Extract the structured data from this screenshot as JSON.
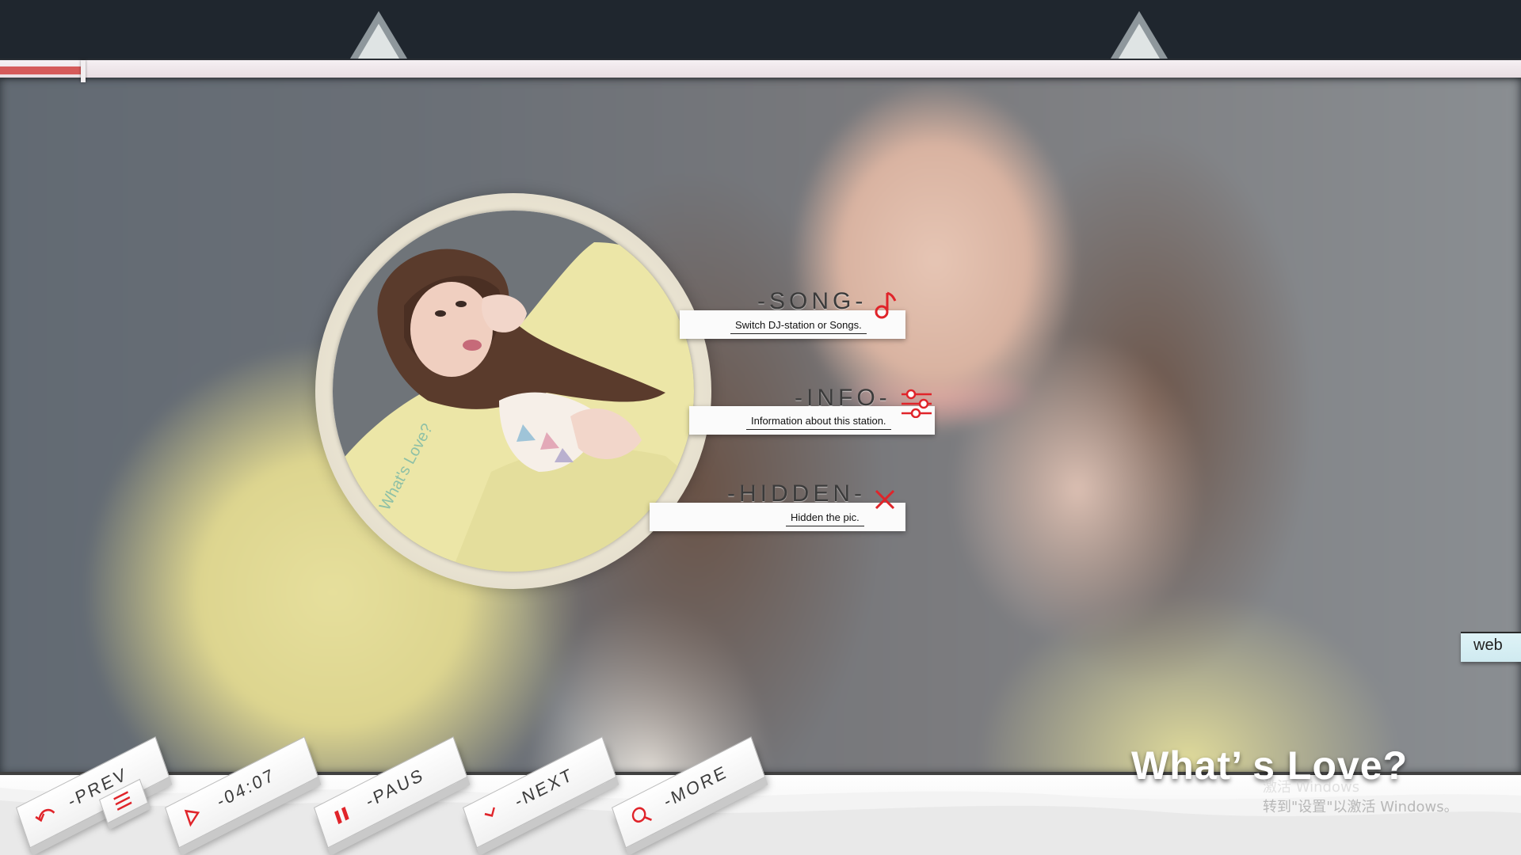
{
  "menu": {
    "song": {
      "title": "-SONG-",
      "desc": "Switch DJ-station or Songs.",
      "icon": "music-note-icon"
    },
    "info": {
      "title": "-INFO-",
      "desc": "Information about this station.",
      "icon": "sliders-icon"
    },
    "hidden": {
      "title": "-HIDDEN-",
      "desc": "Hidden the pic.",
      "icon": "close-icon"
    }
  },
  "controls": {
    "prev": {
      "label": "-PREV",
      "icon": "undo-arrow-icon"
    },
    "time": {
      "label": "-04:07",
      "icon": "play-icon"
    },
    "pause": {
      "label": "-PAUS",
      "icon": "pause-icon"
    },
    "next": {
      "label": "-NEXT",
      "icon": "chevron-right-icon"
    },
    "more": {
      "label": "-MORE",
      "icon": "search-icon"
    },
    "list_icon": "list-icon"
  },
  "playback": {
    "progress": 0.054
  },
  "song_title": "What’ s Love?",
  "album_text": "What's Love?",
  "web_tab": "web",
  "watermark": {
    "line1": "激活 Windows",
    "line2": "转到\"设置\"以激活 Windows。"
  },
  "colors": {
    "accent": "#e0242a",
    "progress": "#d55a5a",
    "topbar": "#1f262e"
  }
}
